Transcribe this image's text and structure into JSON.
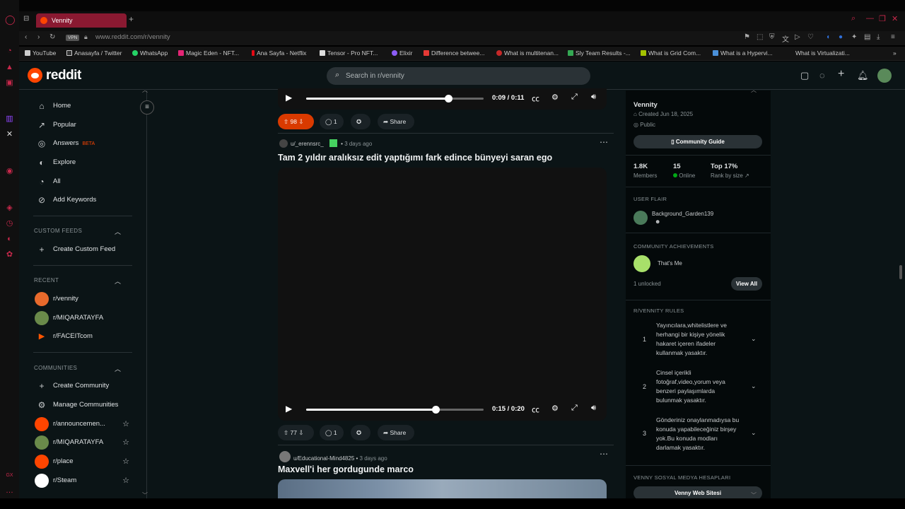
{
  "browser": {
    "tab_title": "Vennity",
    "url": "www.reddit.com/r/vennity",
    "vpn": "VPN",
    "bookmarks": [
      "YouTube",
      "Anasayfa / Twitter",
      "WhatsApp",
      "Magic Eden - NFT...",
      "Ana Sayfa - Netflix",
      "Tensor - Pro NFT...",
      "Elixir",
      "Difference betwee...",
      "What is multitenan...",
      "Sly Team Results -...",
      "What is Grid Com...",
      "What is a Hypervi...",
      "What is Virtualizati..."
    ]
  },
  "header": {
    "logo": "reddit",
    "search_placeholder": "Search in r/vennity"
  },
  "leftnav": {
    "main": [
      {
        "label": "Home",
        "icon": "home-icon"
      },
      {
        "label": "Popular",
        "icon": "popular-icon"
      },
      {
        "label": "Answers",
        "icon": "answers-icon",
        "badge": "BETA"
      },
      {
        "label": "Explore",
        "icon": "explore-icon"
      },
      {
        "label": "All",
        "icon": "all-icon"
      },
      {
        "label": "Add Keywords",
        "icon": "add-keywords-icon"
      }
    ],
    "custom_feeds_title": "CUSTOM FEEDS",
    "create_custom_feed": "Create Custom Feed",
    "recent_title": "RECENT",
    "recent": [
      "r/vennity",
      "r/MIQARATAYFA",
      "r/FACEITcom"
    ],
    "communities_title": "COMMUNITIES",
    "create_community": "Create Community",
    "manage_communities": "Manage Communities",
    "communities": [
      "r/announcemen...",
      "r/MIQARATAYFA",
      "r/place",
      "r/Steam"
    ]
  },
  "posts": [
    {
      "video_time": "0:09 / 0:11",
      "progress": 0.8,
      "votes": "98",
      "comments": "1",
      "share": "Share"
    },
    {
      "author": "u/_erennsrc_",
      "time": "3 days ago",
      "title": "Tam 2 yıldır aralıksız edit yaptığımı fark edince bünyeyi saran ego",
      "video_time": "0:15 / 0:20",
      "progress": 0.73,
      "votes": "77",
      "comments": "1",
      "share": "Share"
    },
    {
      "author": "u/Educational-Mind4825",
      "time": "3 days ago",
      "title": "Maxvell'i her gordugunde marco"
    }
  ],
  "sidebar": {
    "name": "Vennity",
    "created": "Created Jun 18, 2025",
    "visibility": "Public",
    "guide_btn": "Community Guide",
    "members_val": "1.8K",
    "members_lab": "Members",
    "online_val": "15",
    "online_lab": "Online",
    "rank_val": "Top 17%",
    "rank_lab": "Rank by size",
    "user_flair_title": "USER FLAIR",
    "flair_user": "Background_Garden139",
    "achievements_title": "COMMUNITY ACHIEVEMENTS",
    "achievement": "That's Me",
    "unlocked": "1 unlocked",
    "view_all": "View All",
    "rules_title": "R/VENNITY RULES",
    "rules": [
      {
        "num": "1",
        "text": "Yayıncılara,whitelistlere ve herhangi bir kişiye yönelik hakaret içeren ifadeler kullanmak yasaktır."
      },
      {
        "num": "2",
        "text": "Cinsel içerikli fotoğraf,video,yorum veya benzeri paylaşımlarda bulunmak yasaktır."
      },
      {
        "num": "3",
        "text": "Gönderiniz onaylanmadıysa bu konuda yapabileceğiniz birşey yok.Bu konuda modları darlamak yasaktır."
      }
    ],
    "social_title": "VENNY SOSYAL MEDYA HESAPLARI",
    "web_btn": "Venny Web Sitesi"
  },
  "colors": {
    "accent": "#ff4500",
    "upvoted": "#d93a00",
    "tab": "#8a1931",
    "online": "#01a816"
  }
}
